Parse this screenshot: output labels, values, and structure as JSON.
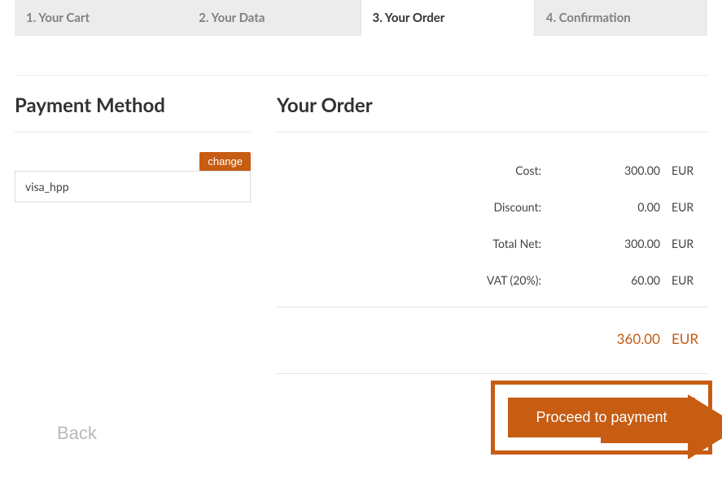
{
  "tabs": [
    {
      "label": "1. Your Cart"
    },
    {
      "label": "2. Your Data"
    },
    {
      "label": "3. Your Order",
      "active": true
    },
    {
      "label": "4. Confirmation"
    }
  ],
  "payment": {
    "heading": "Payment Method",
    "change_label": "change",
    "method_value": "visa_hpp"
  },
  "order": {
    "heading": "Your Order",
    "rows": [
      {
        "label": "Cost:",
        "amount": "300.00",
        "currency": "EUR"
      },
      {
        "label": "Discount:",
        "amount": "0.00",
        "currency": "EUR"
      },
      {
        "label": "Total Net:",
        "amount": "300.00",
        "currency": "EUR"
      },
      {
        "label": "VAT (20%):",
        "amount": "60.00",
        "currency": "EUR"
      }
    ],
    "total": {
      "label": "",
      "amount": "360.00",
      "currency": "EUR"
    }
  },
  "actions": {
    "back_label": "Back",
    "proceed_label": "Proceed to payment"
  },
  "colors": {
    "accent": "#c75c13"
  }
}
